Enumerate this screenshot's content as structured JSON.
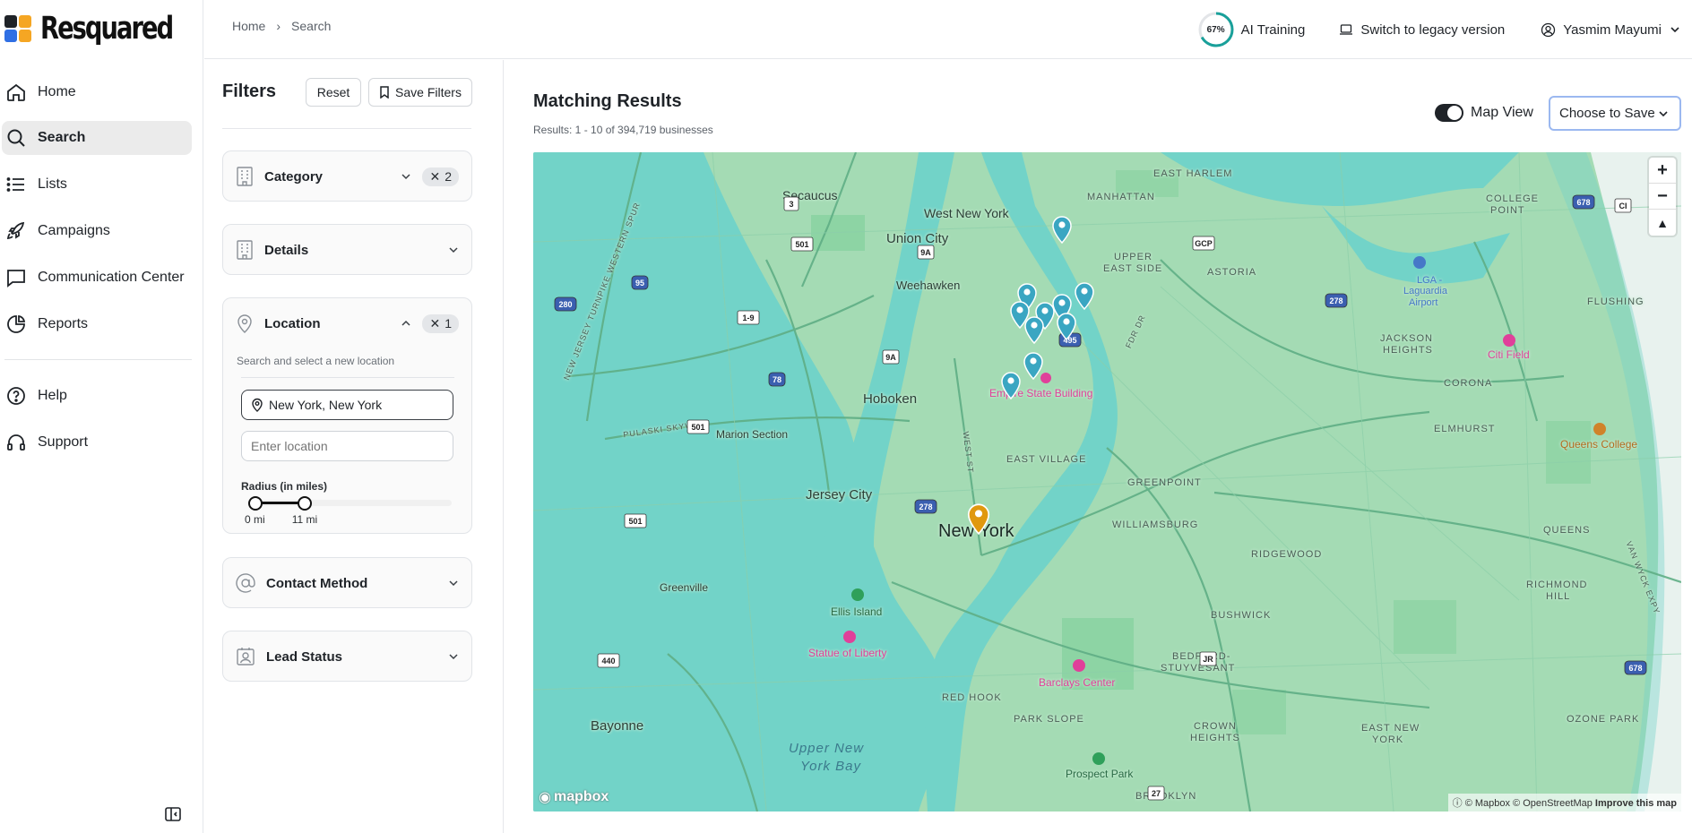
{
  "brand": {
    "name": "Resquared"
  },
  "sidebar": {
    "items": [
      {
        "label": "Home",
        "icon": "home-icon"
      },
      {
        "label": "Search",
        "icon": "search-icon",
        "active": true
      },
      {
        "label": "Lists",
        "icon": "list-icon"
      },
      {
        "label": "Campaigns",
        "icon": "rocket-icon"
      },
      {
        "label": "Communication Center",
        "icon": "message-icon"
      },
      {
        "label": "Reports",
        "icon": "pie-chart-icon"
      }
    ],
    "bottom_items": [
      {
        "label": "Help",
        "icon": "help-icon"
      },
      {
        "label": "Support",
        "icon": "headphones-icon"
      }
    ]
  },
  "breadcrumb": {
    "home": "Home",
    "current": "Search"
  },
  "topbar": {
    "ai_progress": "67%",
    "ai_progress_value": 0.67,
    "ai_label": "AI Training",
    "legacy_label": "Switch to legacy version",
    "user_name": "Yasmim Mayumi"
  },
  "filters": {
    "title": "Filters",
    "reset_label": "Reset",
    "save_label": "Save Filters",
    "category": {
      "label": "Category",
      "count": "2"
    },
    "details": {
      "label": "Details"
    },
    "location": {
      "label": "Location",
      "count": "1",
      "subtitle": "Search and select a new location",
      "selected": "New York, New York",
      "placeholder": "Enter location",
      "radius_label": "Radius (in miles)",
      "radius_min_label": "0 mi",
      "radius_max_label": "11 mi",
      "radius_value_fraction": 0.25
    },
    "contact_method": {
      "label": "Contact Method"
    },
    "lead_status": {
      "label": "Lead Status"
    }
  },
  "results": {
    "title": "Matching Results",
    "count_text": "Results: 1 - 10 of 394,719 businesses",
    "map_view_label": "Map View",
    "map_view_on": true,
    "choose_save_label": "Choose to Save"
  },
  "map": {
    "labels": {
      "secaucus": "Secaucus",
      "west_new_york": "West New York",
      "union_city": "Union City",
      "weehawken": "Weehawken",
      "hoboken": "Hoboken",
      "marion_section": "Marion Section",
      "jersey_city": "Jersey City",
      "greenville": "Greenville",
      "bayonne": "Bayonne",
      "new_york": "New York",
      "east_harlem": "EAST HARLEM",
      "manhattan": "MANHATTAN",
      "upper_east_side_1": "UPPER",
      "upper_east_side_2": "EAST SIDE",
      "astoria": "ASTORIA",
      "college_point_1": "COLLEGE",
      "college_point_2": "POINT",
      "flushing": "FLUSHING",
      "lga_1": "LGA -",
      "lga_2": "Laguardia",
      "lga_3": "Airport",
      "jackson_heights_1": "JACKSON",
      "jackson_heights_2": "HEIGHTS",
      "citi_field": "Citi Field",
      "corona": "CORONA",
      "elmhurst": "ELMHURST",
      "queens_college": "Queens College",
      "empire_state": "Empire State Building",
      "east_village": "EAST VILLAGE",
      "greenpoint": "GREENPOINT",
      "williamsburg": "WILLIAMSBURG",
      "ridgewood": "RIDGEWOOD",
      "queens": "QUEENS",
      "richmond_hill_1": "RICHMOND",
      "richmond_hill_2": "HILL",
      "ellis_island": "Ellis Island",
      "statue_of_liberty": "Statue of Liberty",
      "bushwick": "BUSHWICK",
      "bedford_1": "BEDFORD-",
      "bedford_2": "STUYVESANT",
      "barclays": "Barclays Center",
      "red_hook": "RED HOOK",
      "park_slope": "PARK SLOPE",
      "crown_heights_1": "CROWN",
      "crown_heights_2": "HEIGHTS",
      "east_new_york_1": "EAST NEW",
      "east_new_york_2": "YORK",
      "ozone_park": "OZONE PARK",
      "upper_bay_1": "Upper New",
      "upper_bay_2": "York Bay",
      "prospect_park": "Prospect Park",
      "brooklyn": "BROOKLYN",
      "pulaski": "PULASKI SKYWAY",
      "turnpike": "NEW JERSEY TURNPIKE WESTERN SPUR",
      "west_st": "WEST ST",
      "fdr": "FDR DR",
      "van_wyck": "VAN WYCK EXPY"
    },
    "shields": {
      "r3": "3",
      "r501a": "501",
      "r9a": "9A",
      "r1_9": "1-9",
      "i95": "95",
      "i280": "280",
      "r9a2": "9A",
      "i78": "78",
      "r501b": "501",
      "r501c": "501",
      "r440": "440",
      "i278a": "278",
      "i278b": "278",
      "i495": "495",
      "i678a": "678",
      "i678b": "678",
      "gcp": "GCP",
      "jr": "JR",
      "ci": "CI",
      "r27": "27"
    },
    "attribution": "© Mapbox © OpenStreetMap",
    "improve": "Improve this map",
    "logo_text": "mapbox"
  }
}
